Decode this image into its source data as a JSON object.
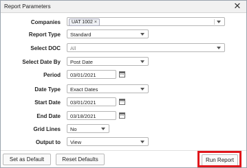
{
  "window": {
    "title": "Report Parameters"
  },
  "fields": {
    "companies": {
      "label": "Companies",
      "tag": "UAT 1002",
      "tag_remove": "×"
    },
    "report_type": {
      "label": "Report Type",
      "value": "Standard"
    },
    "select_doc": {
      "label": "Select DOC",
      "value": "All"
    },
    "select_date_by": {
      "label": "Select Date By",
      "value": "Post Date"
    },
    "period": {
      "label": "Period",
      "value": "03/01/2021"
    },
    "date_type": {
      "label": "Date Type",
      "value": "Exact Dates"
    },
    "start_date": {
      "label": "Start Date",
      "value": "03/01/2021"
    },
    "end_date": {
      "label": "End Date",
      "value": "03/18/2021"
    },
    "grid_lines": {
      "label": "Grid Lines",
      "value": "No"
    },
    "output_to": {
      "label": "Output to",
      "value": "View"
    }
  },
  "buttons": {
    "set_default": "Set as Default",
    "reset_defaults": "Reset Defaults",
    "run_report": "Run Report"
  },
  "colors": {
    "highlight": "#e0151b"
  }
}
